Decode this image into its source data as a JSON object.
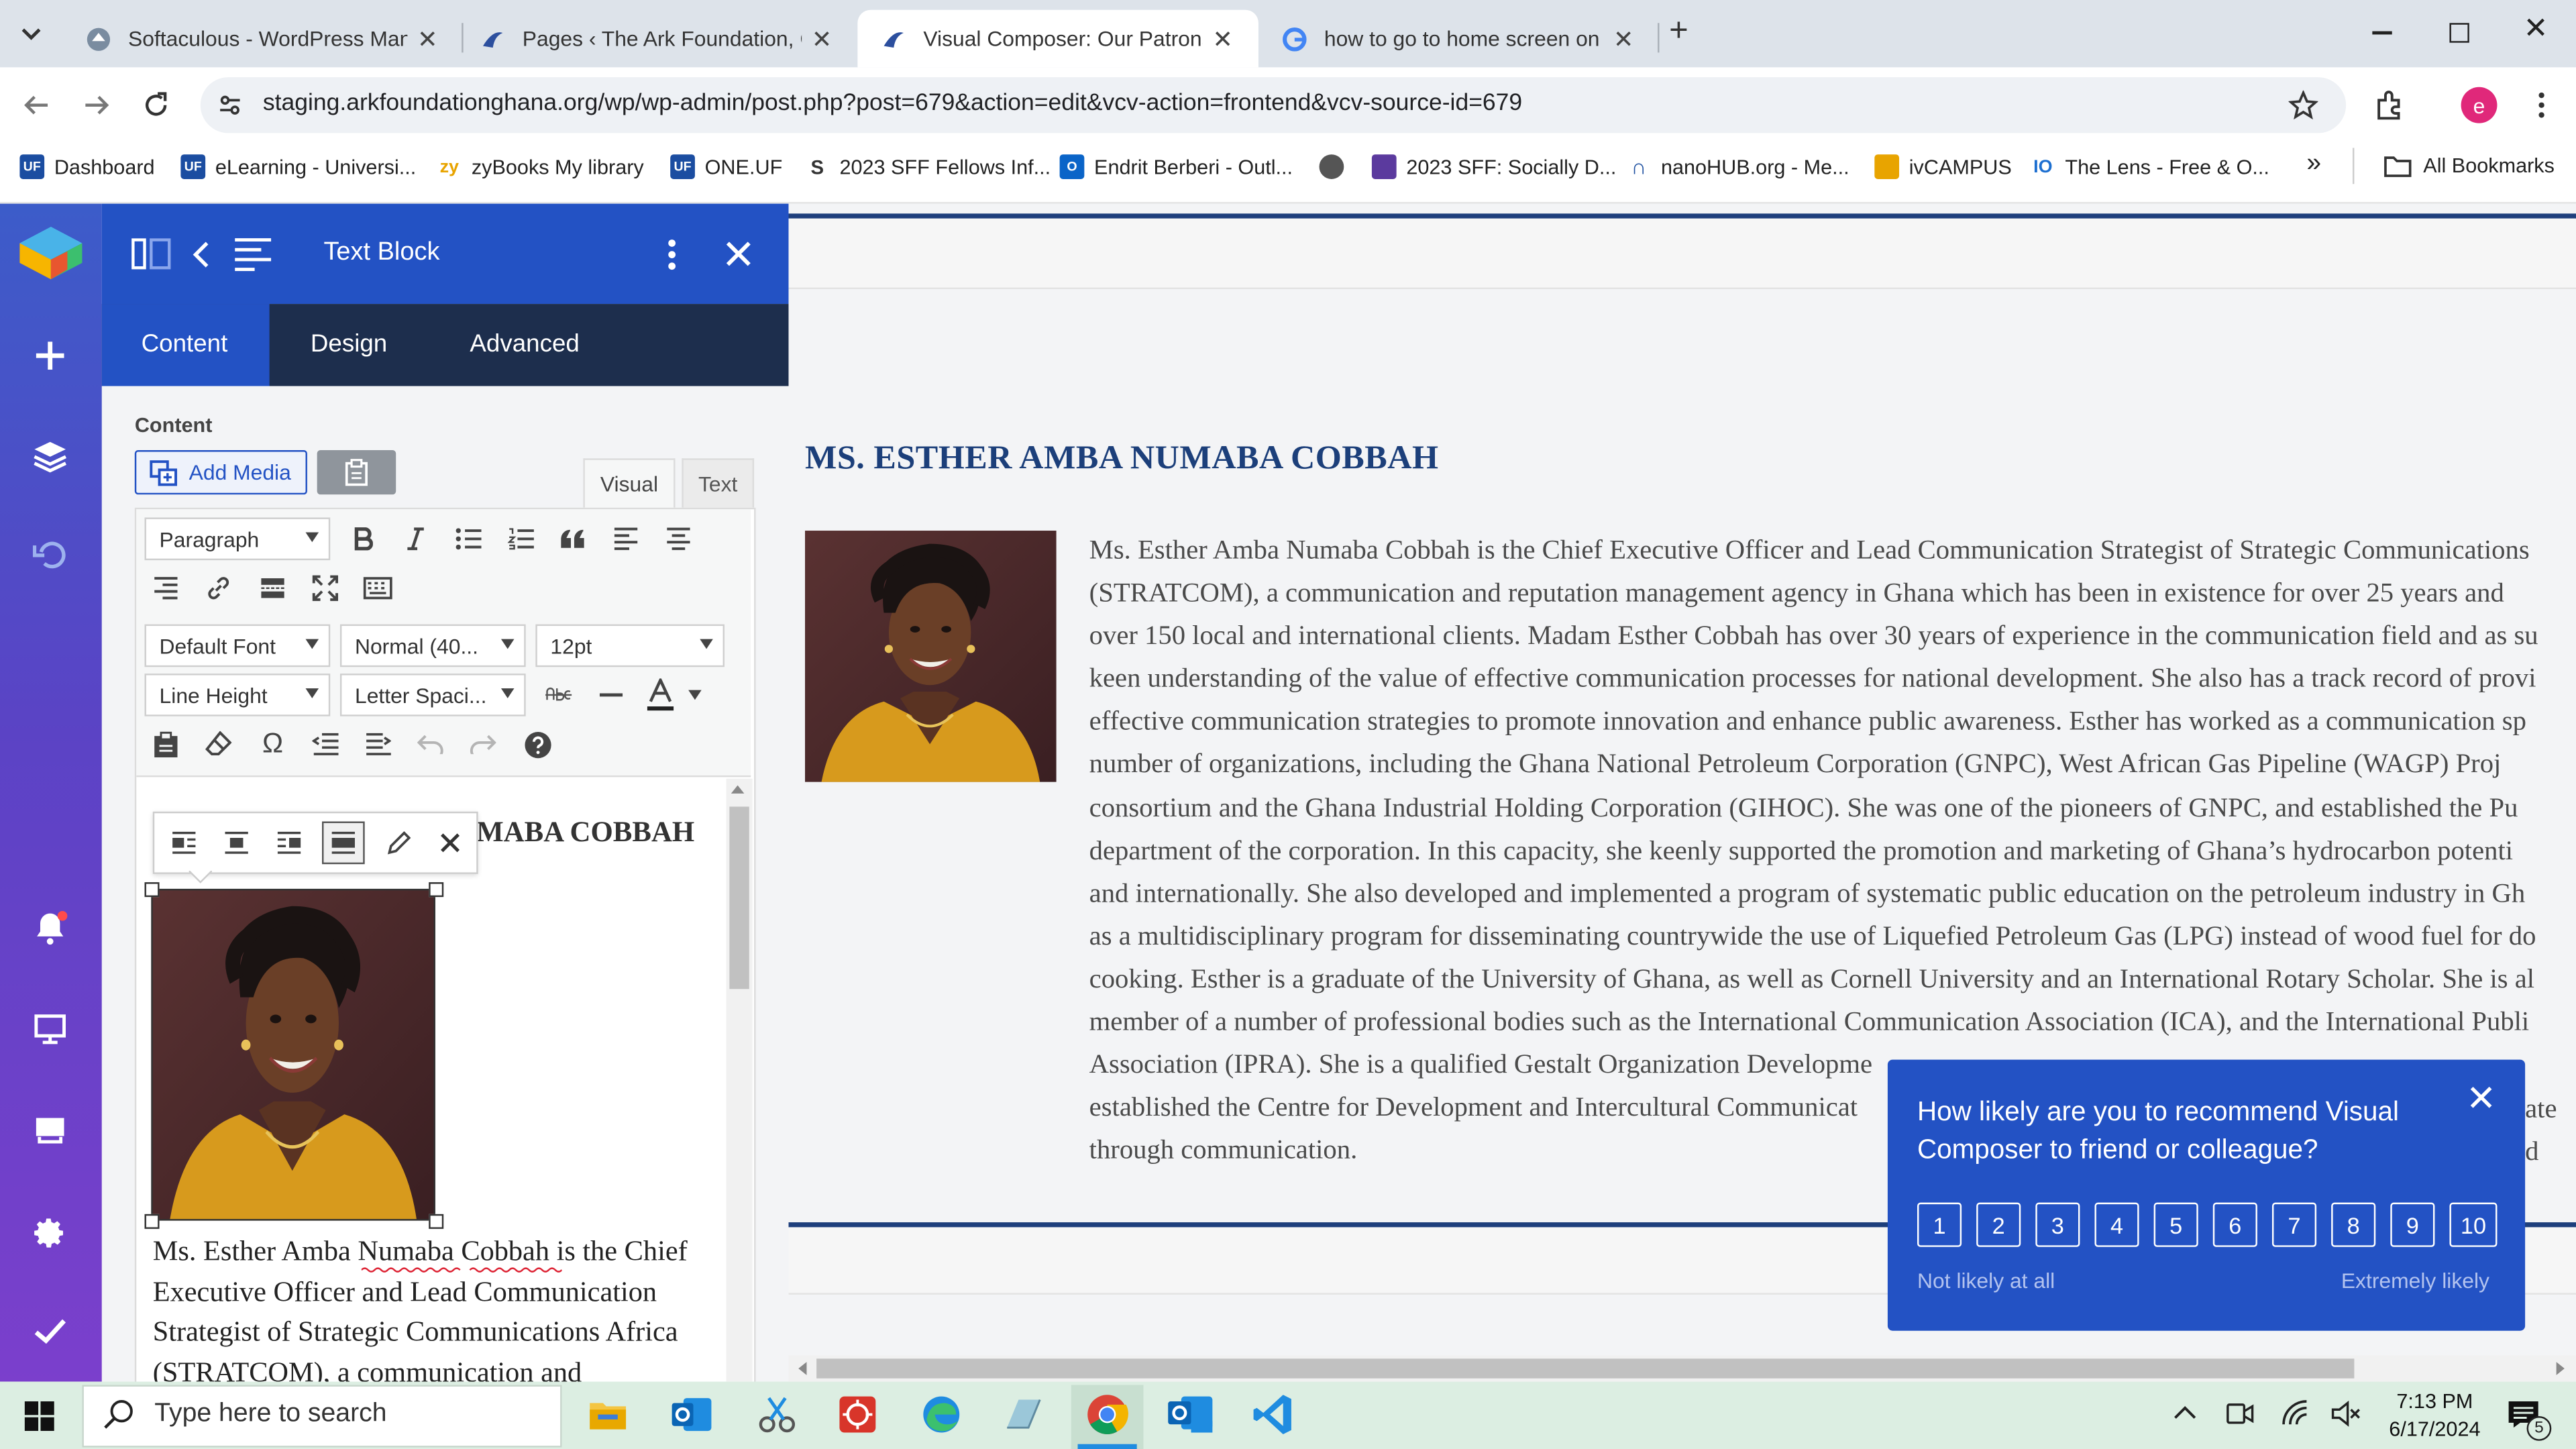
{
  "browser": {
    "tabs": [
      {
        "title": "Softaculous - WordPress Manag",
        "close": "✕"
      },
      {
        "title": "Pages ‹ The Ark Foundation, Gh",
        "close": "✕"
      },
      {
        "title": "Visual Composer: Our Patrons",
        "close": "✕"
      },
      {
        "title": "how to go to home screen on v",
        "close": "✕"
      }
    ],
    "url": "staging.arkfoundationghana.org/wp/wp-admin/post.php?post=679&action=edit&vcv-action=frontend&vcv-source-id=679",
    "profile_initial": "e",
    "bookmarks": [
      {
        "label": "Dashboard"
      },
      {
        "label": "eLearning - Universi..."
      },
      {
        "label": "zyBooks My library"
      },
      {
        "label": "ONE.UF"
      },
      {
        "label": "2023 SFF Fellows Inf..."
      },
      {
        "label": "Endrit Berberi - Outl..."
      },
      {
        "label": "2023 SFF: Socially D..."
      },
      {
        "label": "nanoHUB.org - Me..."
      },
      {
        "label": "ivCAMPUS"
      },
      {
        "label": "The Lens - Free & O..."
      }
    ],
    "all_bookmarks": "All Bookmarks",
    "more_bookmarks": "»"
  },
  "panel": {
    "title": "Text Block",
    "tabs": [
      {
        "label": "Content"
      },
      {
        "label": "Design"
      },
      {
        "label": "Advanced"
      }
    ],
    "section_label": "Content",
    "add_media": "Add Media",
    "mode_visual": "Visual",
    "mode_text": "Text",
    "paragraph_select": "Paragraph",
    "font_select": "Default Font",
    "weight_select": "Normal (40...",
    "size_select": "12pt",
    "line_height_select": "Line Height",
    "letter_spacing_select": "Letter Spaci...",
    "heading_partial": "MABA COBBAH",
    "editor_text_lines": [
      "Ms. Esther Amba Numaba Cobbah is the Chief",
      "Executive Officer and Lead Communication",
      "Strategist of Strategic Communications Africa",
      "(STRATCOM), a communication and"
    ]
  },
  "preview": {
    "name_heading": "MS. ESTHER AMBA NUMABA COBBAH",
    "bio_lines": [
      "Ms. Esther Amba Numaba Cobbah is the Chief Executive Officer and Lead Communication Strategist of Strategic Communications",
      "(STRATCOM), a communication and reputation management agency in Ghana which has been in existence for over 25 years and",
      "over 150 local and international clients. Madam Esther Cobbah has over 30 years of experience in the communication field and as su",
      "keen understanding of the value of effective communication processes for national development. She also has a track record of provi",
      "effective communication strategies to promote innovation and enhance public awareness. Esther has worked as a communication sp",
      "number of organizations, including the Ghana National Petroleum Corporation (GNPC), West African Gas Pipeline (WAGP) Proj",
      "consortium and the Ghana Industrial Holding Corporation (GIHOC). She was one of the pioneers of GNPC, and established the Pu",
      "department of the corporation. In this capacity, she keenly supported the promotion and marketing of Ghana’s hydrocarbon potenti",
      "and internationally. She also developed and implemented a program of systematic public education on the petroleum industry in Gh",
      "as a multidisciplinary program for disseminating countrywide the use of Liquefied Petroleum Gas (LPG) instead of wood fuel for do",
      "cooking. Esther is a graduate of the University of Ghana, as well as Cornell University and an International Rotary Scholar. She is al",
      "member of a number of professional bodies such as the International Communication Association (ICA), and the International Publi",
      "Association (IPRA). She is a qualified Gestalt Organization Developme",
      "established the Centre for Development and Intercultural Communicat",
      "through communication."
    ],
    "bio_right_fragments": [
      "ate d"
    ]
  },
  "survey": {
    "question": "How likely are you to recommend Visual Composer to friend or colleague?",
    "scale": [
      "1",
      "2",
      "3",
      "4",
      "5",
      "6",
      "7",
      "8",
      "9",
      "10"
    ],
    "low_label": "Not likely at all",
    "high_label": "Extremely likely",
    "close": "✕"
  },
  "taskbar": {
    "search_placeholder": "Type here to search",
    "time": "7:13 PM",
    "date": "6/17/2024",
    "notification_count": "5"
  },
  "colors": {
    "vc_blue": "#2352c4",
    "vc_dark": "#1d2e4d",
    "heading_navy": "#1c3f7a",
    "tab_strip": "#dde3ea"
  }
}
